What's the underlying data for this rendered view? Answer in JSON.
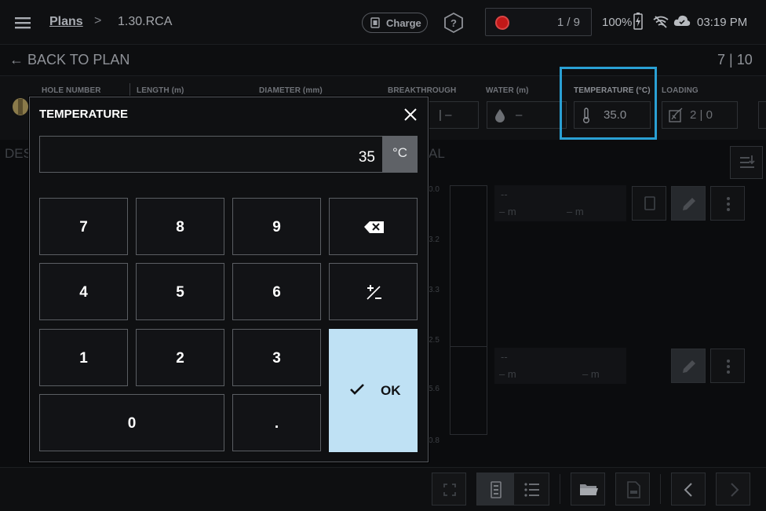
{
  "header": {
    "breadcrumb": {
      "parent": "Plans",
      "separator": ">",
      "current": "1.30.RCA"
    },
    "charge_label": "Charge",
    "record_counter": "1 / 9",
    "battery_percent": "100%",
    "clock": "03:19 PM"
  },
  "navbar": {
    "back_label": "← BACK TO PLAN",
    "page_counter": "7 | 10"
  },
  "hole_info": {
    "columns": {
      "hole_number": "HOLE NUMBER",
      "length": "LENGTH (m)",
      "diameter": "DIAMETER (mm)",
      "breakthrough": "BREAKTHROUGH",
      "water": "WATER (m)",
      "temperature": "TEMPERATURE (°C)",
      "loading": "LOADING"
    },
    "values": {
      "breakthrough": "| –",
      "water": "–",
      "temperature": "35.0",
      "loading": "2 | 0"
    }
  },
  "background": {
    "section_left": "DES",
    "section_right": "AL",
    "scale_labels": [
      "0.0",
      "3.2",
      "3.3",
      "2.5",
      "5.6",
      "0.8"
    ],
    "decks": [
      {
        "name": "--",
        "m1": "– m",
        "m2": "– m"
      },
      {
        "name": "--",
        "m1": "– m",
        "m2": "– m"
      }
    ]
  },
  "dialog": {
    "title": "TEMPERATURE",
    "input_value": "35",
    "unit": "°C",
    "keys": {
      "k7": "7",
      "k8": "8",
      "k9": "9",
      "k4": "4",
      "k5": "5",
      "k6": "6",
      "k1": "1",
      "k2": "2",
      "k3": "3",
      "k0": "0",
      "dot": "."
    },
    "ok_label": "OK"
  },
  "colors": {
    "highlight": "#2aa0d4",
    "ok_button": "#bfe1f4",
    "record_dot": "#c21818"
  }
}
